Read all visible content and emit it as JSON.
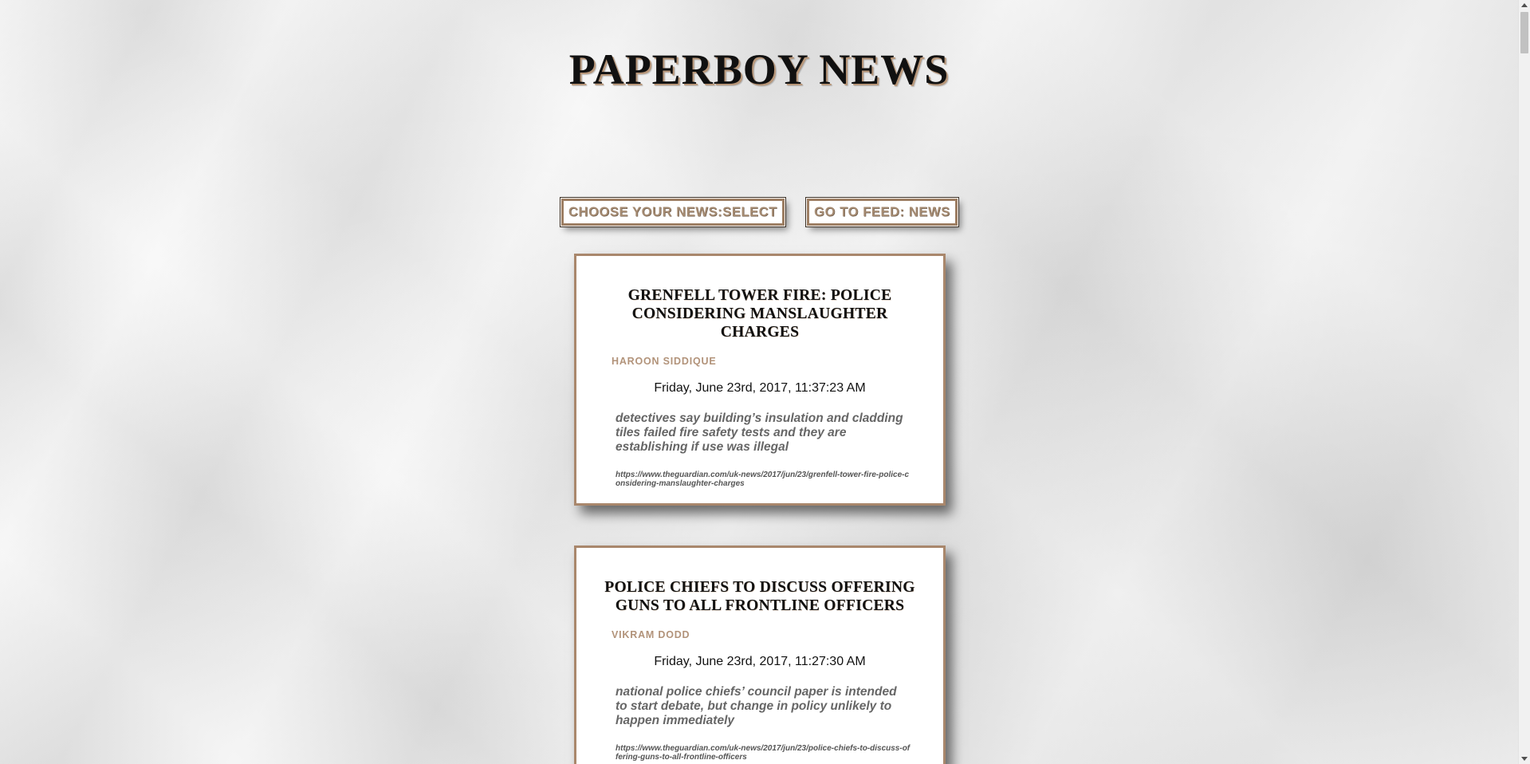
{
  "header": {
    "title": "PAPERBOY NEWS"
  },
  "nav": {
    "choose_label": "CHOOSE YOUR NEWS:SELECT",
    "feed_label": "GO TO FEED: NEWS"
  },
  "articles": [
    {
      "headline": "GRENFELL TOWER FIRE: POLICE CONSIDERING MANSLAUGHTER CHARGES",
      "author": "HAROON SIDDIQUE",
      "date": "Friday, June 23rd, 2017, 11:37:23 AM",
      "summary": "detectives say building’s insulation and cladding tiles failed fire safety tests and they are establishing if use was illegal",
      "url": "https://www.theguardian.com/uk-news/2017/jun/23/grenfell-tower-fire-police-considering-manslaughter-charges"
    },
    {
      "headline": "POLICE CHIEFS TO DISCUSS OFFERING GUNS TO ALL FRONTLINE OFFICERS",
      "author": "VIKRAM DODD",
      "date": "Friday, June 23rd, 2017, 11:27:30 AM",
      "summary": "national police chiefs’ council paper is intended to start debate, but change in policy unlikely to happen immediately",
      "url": "https://www.theguardian.com/uk-news/2017/jun/23/police-chiefs-to-discuss-offering-guns-to-all-frontline-officers"
    }
  ],
  "colors": {
    "accent_border": "#a9876c",
    "author_text": "#b2937a",
    "background": "#eeeeee"
  }
}
